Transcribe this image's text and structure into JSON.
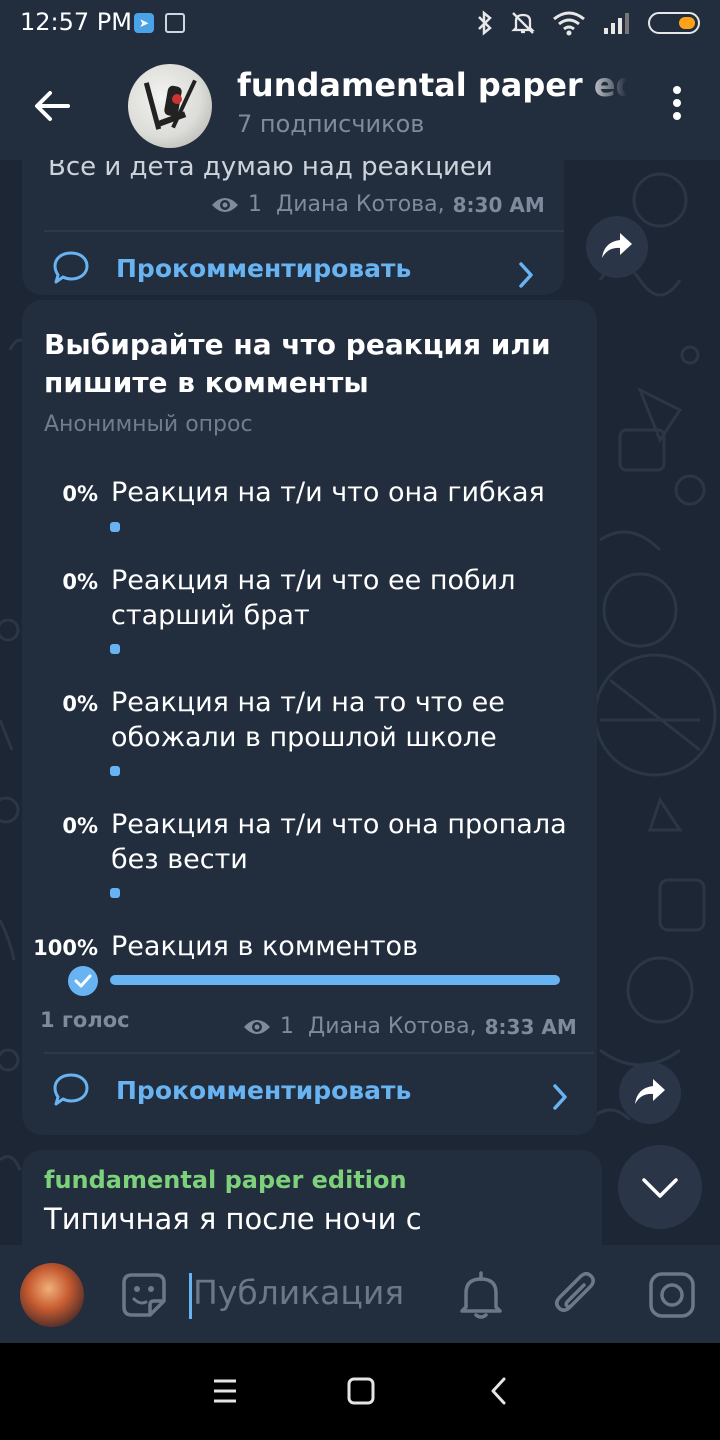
{
  "status_bar": {
    "time": "12:57 PM",
    "icons": [
      "telegram-icon",
      "gallery-icon",
      "bluetooth-icon",
      "mute-icon",
      "wifi-icon",
      "signal-icon",
      "battery-icon"
    ]
  },
  "header": {
    "title": "fundamental paper edition",
    "subscribers": "7 подписчиков"
  },
  "messages": [
    {
      "partial_text": "Все и дета думаю над реакцией",
      "views": "1",
      "author": "Диана Котова,",
      "time": "8:30 AM",
      "comment_label": "Прокомментировать"
    },
    {
      "poll": {
        "question": "Выбирайте на что реакция или пишите в комменты",
        "type": "Анонимный опрос",
        "options": [
          {
            "percent": "0%",
            "text": "Реакция на т/и что она гибкая",
            "value": 0
          },
          {
            "percent": "0%",
            "text": "Реакция на т/и что ее побил старший брат",
            "value": 0
          },
          {
            "percent": "0%",
            "text": "Реакция на т/и на то что ее обожали в прошлой школе",
            "value": 0
          },
          {
            "percent": "0%",
            "text": "Реакция на т/и что она пропала без вести",
            "value": 0
          },
          {
            "percent": "100%",
            "text": "Реакция в комментов",
            "value": 100,
            "chosen": true
          }
        ],
        "votes": "1 голос"
      },
      "views": "1",
      "author": "Диана Котова,",
      "time": "8:33 AM",
      "comment_label": "Прокомментировать"
    },
    {
      "author": "fundamental paper edition",
      "text": "Типичная я после ночи с"
    }
  ],
  "input": {
    "placeholder": "Публикация"
  },
  "colors": {
    "accent": "#68b3f2",
    "author_green": "#7cd17a",
    "bubble": "#222d3d",
    "background": "#1c2634"
  }
}
